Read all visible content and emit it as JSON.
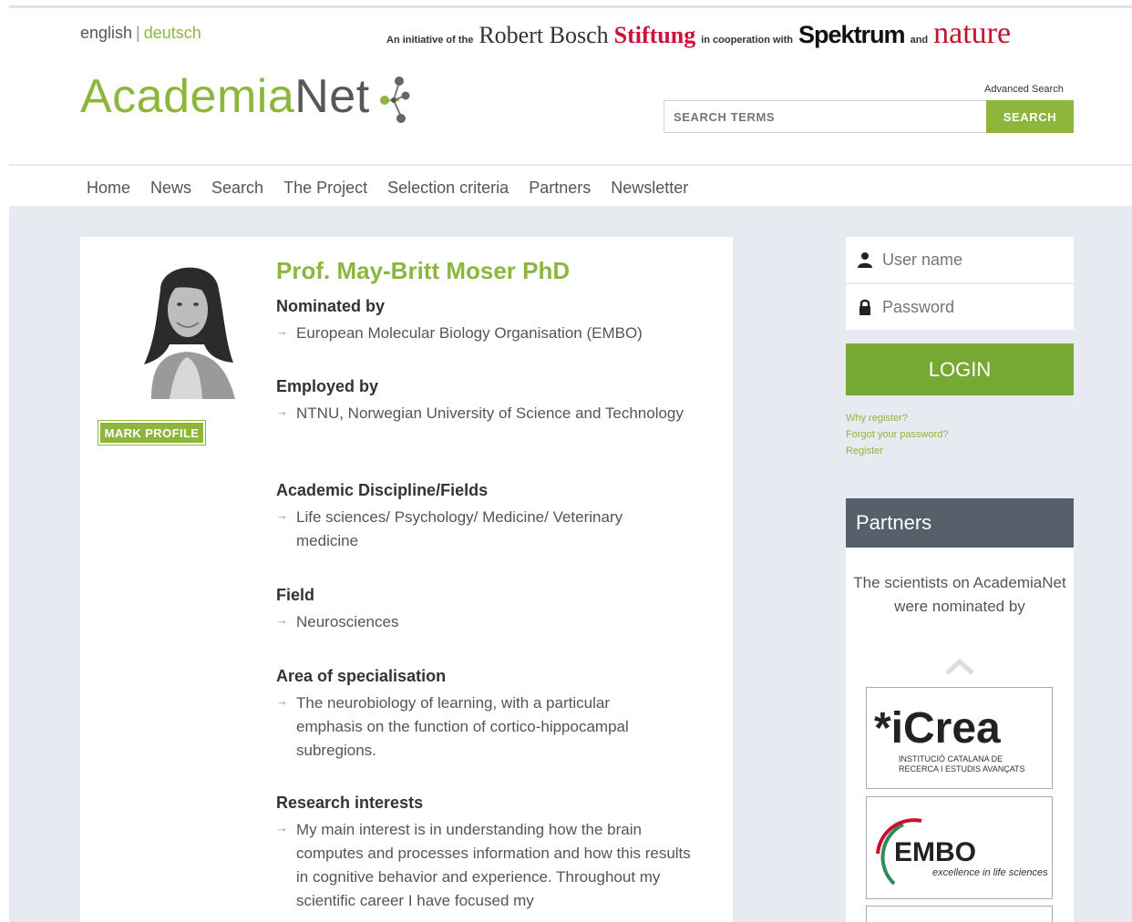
{
  "header": {
    "lang_en": "english",
    "lang_sep": "|",
    "lang_de": "deutsch",
    "initiative_prefix": "An initiative of the",
    "robert_bosch": "Robert Bosch",
    "stiftung": "Stiftung",
    "cooperation": "in cooperation with",
    "spektrum": "Spektrum",
    "and": "and",
    "nature": "nature",
    "logo_part1": "Academia",
    "logo_part2": "Net",
    "advanced_search": "Advanced Search",
    "search_placeholder": "SEARCH TERMS",
    "search_button": "SEARCH"
  },
  "nav": [
    "Home",
    "News",
    "Search",
    "The Project",
    "Selection criteria",
    "Partners",
    "Newsletter"
  ],
  "profile": {
    "name": "Prof. May-Britt Moser PhD",
    "mark_button": "MARK PROFILE",
    "sections": [
      {
        "heading": "Nominated by",
        "value": "European Molecular Biology Organisation (EMBO)"
      },
      {
        "heading": "Employed by",
        "value": "NTNU, Norwegian University of Science and Technology"
      },
      {
        "heading": "Academic Discipline/Fields",
        "value": "Life sciences/ Psychology/ Medicine/ Veterinary medicine"
      },
      {
        "heading": "Field",
        "value": "Neurosciences"
      },
      {
        "heading": "Area of specialisation",
        "value": "The neurobiology of learning, with a particular emphasis on the function of cortico-hippocampal subregions."
      },
      {
        "heading": "Research interests",
        "value": "My main interest is in understanding how the brain computes and processes information and how this results in cognitive behavior and experience. Throughout my scientific career I have focused my"
      }
    ]
  },
  "login": {
    "username_placeholder": "User name",
    "password_placeholder": "Password",
    "login_button": "LOGIN",
    "why_register": "Why register?",
    "forgot_password": "Forgot your password?",
    "register": "Register"
  },
  "partners": {
    "title": "Partners",
    "text": "The scientists on AcademiaNet were nominated by",
    "icrea_brand": "*iCrea",
    "icrea_line1": "INSTITUCIÓ CATALANA DE",
    "icrea_line2": "RECERCA I ESTUDIS AVANÇATS",
    "embo_brand": "EMBO",
    "embo_tagline": "excellence in life sciences"
  },
  "colors": {
    "brand_green": "#8cb63c",
    "login_green": "#76a934",
    "partners_header": "#56606b",
    "band_grey": "#e8eaf1",
    "stiftung_red": "#d0103a"
  }
}
